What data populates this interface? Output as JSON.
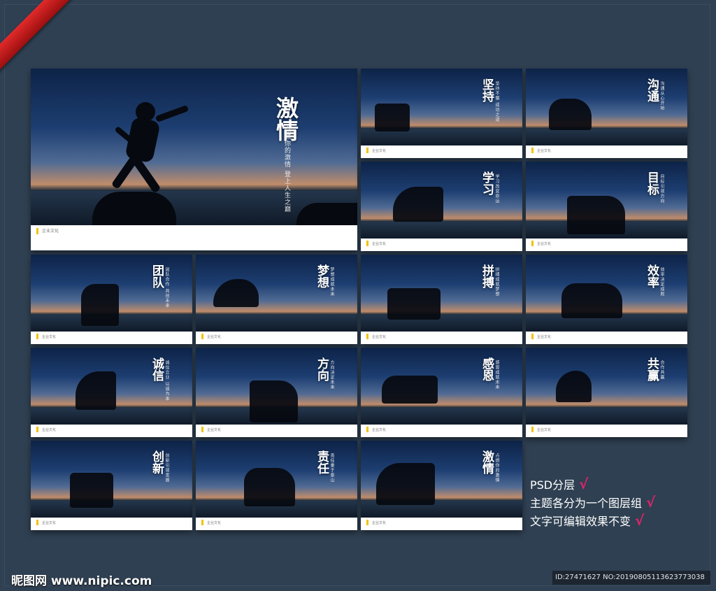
{
  "hero": {
    "title": "激情",
    "subtitle": "点燃你的激情 登上人生之巅",
    "footer": "企业文化"
  },
  "cards": [
    {
      "title": "坚持",
      "subtitle": "坚持不懈 成功之道",
      "footer": "企业文化"
    },
    {
      "title": "沟通",
      "subtitle": "沟通从心开始",
      "footer": "企业文化"
    },
    {
      "title": "学习",
      "subtitle": "学习改变命运",
      "footer": "企业文化"
    },
    {
      "title": "目标",
      "subtitle": "目标引领方向",
      "footer": "企业文化"
    },
    {
      "title": "团队",
      "subtitle": "团队合作 共创未来",
      "footer": "企业文化"
    },
    {
      "title": "梦想",
      "subtitle": "梦想成就未来",
      "footer": "企业文化"
    },
    {
      "title": "拼搏",
      "subtitle": "拼搏成就梦想",
      "footer": "企业文化"
    },
    {
      "title": "效率",
      "subtitle": "效率决定成败",
      "footer": "企业文化"
    },
    {
      "title": "诚信",
      "subtitle": "诚信立业 以诚为本",
      "footer": "企业文化"
    },
    {
      "title": "方向",
      "subtitle": "方向决定未来",
      "footer": "企业文化"
    },
    {
      "title": "感恩",
      "subtitle": "感恩成就未来",
      "footer": "企业文化"
    },
    {
      "title": "共赢",
      "subtitle": "合作共赢",
      "footer": "企业文化"
    },
    {
      "title": "创新",
      "subtitle": "创新引领发展",
      "footer": "企业文化"
    },
    {
      "title": "责任",
      "subtitle": "责任重于泰山",
      "footer": "企业文化"
    },
    {
      "title": "激情",
      "subtitle": "点燃你的激情",
      "footer": "企业文化"
    }
  ],
  "promo": {
    "line1": "PSD分层",
    "line2": "主题各分为一个图层组",
    "line3": "文字可编辑效果不变",
    "check": "√"
  },
  "watermark": {
    "brand": "昵图网 www.nipic.com"
  },
  "idbar": {
    "text": "ID:27471627 NO:20190805113623773038"
  },
  "colors": {
    "background": "#304153",
    "ribbon": "#d42222",
    "check": "#e0246a",
    "accent": "#f2c200"
  }
}
